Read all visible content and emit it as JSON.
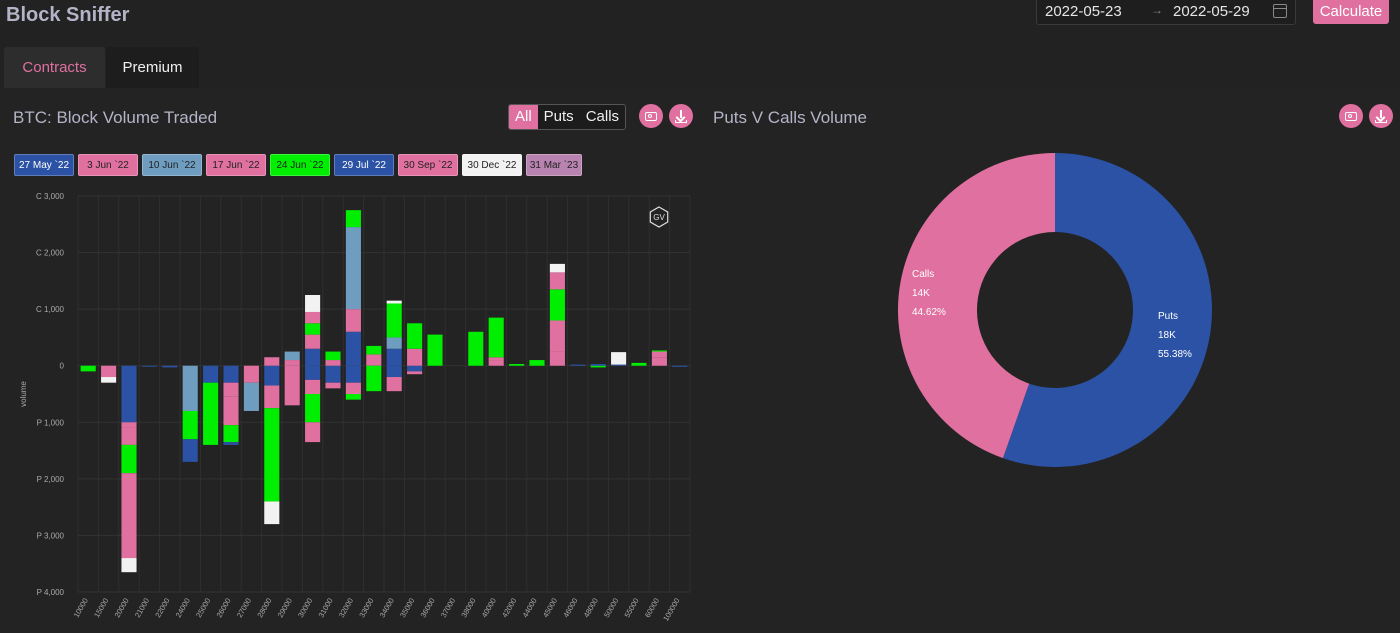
{
  "app": {
    "title": "Block Sniffer"
  },
  "date_range": {
    "start": "2022-05-23",
    "end": "2022-05-29",
    "separator": "→"
  },
  "calculate_label": "Calculate",
  "tabs": [
    {
      "label": "Contracts",
      "active": true
    },
    {
      "label": "Premium",
      "active": false
    }
  ],
  "left_panel": {
    "title": "BTC: Block Volume Traded",
    "filters": [
      {
        "label": "All",
        "active": true
      },
      {
        "label": "Puts",
        "active": false
      },
      {
        "label": "Calls",
        "active": false
      }
    ],
    "watermark": "GV"
  },
  "right_panel": {
    "title": "Puts V Calls Volume"
  },
  "colors": {
    "accent": "#e0709f",
    "bg": "#222222"
  },
  "chart_data": [
    {
      "type": "bar",
      "stacked": true,
      "ylabel": "volume",
      "ylim": [
        -4000,
        3000
      ],
      "y_ticks": [
        {
          "v": 3000,
          "label": "C 3,000"
        },
        {
          "v": 2000,
          "label": "C 2,000"
        },
        {
          "v": 1000,
          "label": "C 1,000"
        },
        {
          "v": 0,
          "label": "0"
        },
        {
          "v": -1000,
          "label": "P 1,000"
        },
        {
          "v": -2000,
          "label": "P 2,000"
        },
        {
          "v": -3000,
          "label": "P 3,000"
        },
        {
          "v": -4000,
          "label": "P 4,000"
        }
      ],
      "categories": [
        "10000",
        "15000",
        "20000",
        "21000",
        "22000",
        "24000",
        "25000",
        "26000",
        "27000",
        "28000",
        "29000",
        "30000",
        "31000",
        "32000",
        "33000",
        "34000",
        "35000",
        "36000",
        "37000",
        "38000",
        "40000",
        "42000",
        "44000",
        "45000",
        "46000",
        "48000",
        "50000",
        "55000",
        "60000",
        "100000"
      ],
      "series": [
        {
          "name": "27 May `22",
          "color": "#2b52a4",
          "calls": [
            0,
            0,
            0,
            0,
            0,
            0,
            0,
            0,
            0,
            0,
            0,
            300,
            0,
            600,
            0,
            300,
            0,
            0,
            0,
            0,
            0,
            0,
            0,
            0,
            20,
            0,
            20,
            0,
            0,
            0
          ],
          "puts": [
            0,
            0,
            1000,
            10,
            30,
            0,
            300,
            300,
            0,
            350,
            0,
            250,
            300,
            300,
            0,
            200,
            100,
            0,
            0,
            0,
            0,
            0,
            0,
            0,
            0,
            0,
            0,
            0,
            0,
            20
          ]
        },
        {
          "name": "3 Jun `22",
          "color": "#e0709f",
          "calls": [
            0,
            0,
            0,
            0,
            0,
            0,
            0,
            0,
            0,
            0,
            100,
            250,
            100,
            400,
            200,
            0,
            300,
            0,
            0,
            0,
            100,
            0,
            0,
            250,
            0,
            0,
            0,
            0,
            150,
            0
          ],
          "puts": [
            0,
            200,
            100,
            0,
            0,
            0,
            0,
            250,
            300,
            0,
            0,
            250,
            100,
            200,
            0,
            0,
            50,
            0,
            0,
            0,
            0,
            0,
            0,
            0,
            0,
            0,
            0,
            0,
            0,
            0
          ]
        },
        {
          "name": "10 Jun `22",
          "color": "#6f9dc0",
          "calls": [
            0,
            0,
            0,
            0,
            0,
            0,
            0,
            0,
            0,
            0,
            150,
            0,
            0,
            1450,
            0,
            200,
            0,
            0,
            0,
            0,
            0,
            0,
            0,
            0,
            0,
            0,
            0,
            0,
            0,
            0
          ],
          "puts": [
            0,
            0,
            0,
            0,
            0,
            800,
            0,
            0,
            500,
            0,
            0,
            0,
            0,
            0,
            0,
            0,
            0,
            0,
            0,
            0,
            0,
            0,
            0,
            0,
            0,
            0,
            0,
            0,
            0,
            0
          ]
        },
        {
          "name": "17 Jun `22",
          "color": "#e0709f",
          "calls": [
            0,
            0,
            0,
            0,
            0,
            0,
            0,
            0,
            0,
            150,
            0,
            0,
            0,
            0,
            0,
            0,
            0,
            0,
            0,
            0,
            50,
            0,
            0,
            550,
            0,
            0,
            0,
            0,
            100,
            0
          ],
          "puts": [
            0,
            0,
            300,
            0,
            0,
            0,
            0,
            500,
            0,
            400,
            700,
            0,
            0,
            0,
            0,
            250,
            0,
            0,
            0,
            0,
            0,
            0,
            0,
            0,
            0,
            0,
            0,
            0,
            0,
            0
          ]
        },
        {
          "name": "24 Jun `22",
          "color": "#00ee00",
          "calls": [
            0,
            0,
            0,
            0,
            0,
            0,
            0,
            0,
            0,
            0,
            0,
            200,
            150,
            300,
            150,
            600,
            450,
            550,
            0,
            600,
            700,
            30,
            100,
            550,
            0,
            0,
            0,
            50,
            20,
            0
          ],
          "puts": [
            100,
            0,
            500,
            0,
            0,
            500,
            1100,
            300,
            0,
            1650,
            0,
            500,
            0,
            100,
            450,
            0,
            0,
            0,
            0,
            0,
            0,
            0,
            0,
            0,
            0,
            30,
            0,
            0,
            0,
            0
          ]
        },
        {
          "name": "29 Jul `22",
          "color": "#2b52a4",
          "calls": [
            0,
            0,
            0,
            0,
            0,
            0,
            0,
            0,
            0,
            0,
            0,
            0,
            0,
            0,
            0,
            0,
            0,
            0,
            0,
            0,
            0,
            0,
            0,
            0,
            0,
            30,
            0,
            0,
            0,
            0
          ],
          "puts": [
            0,
            0,
            0,
            0,
            0,
            400,
            0,
            50,
            0,
            0,
            0,
            0,
            0,
            0,
            0,
            0,
            0,
            0,
            0,
            0,
            0,
            0,
            0,
            0,
            0,
            0,
            0,
            0,
            0,
            0
          ]
        },
        {
          "name": "30 Sep `22",
          "color": "#e0709f",
          "calls": [
            0,
            0,
            0,
            0,
            0,
            0,
            0,
            0,
            0,
            0,
            0,
            200,
            0,
            0,
            0,
            0,
            0,
            0,
            0,
            0,
            0,
            0,
            0,
            300,
            0,
            0,
            0,
            0,
            0,
            0
          ],
          "puts": [
            0,
            0,
            1500,
            0,
            0,
            0,
            0,
            0,
            0,
            0,
            0,
            350,
            0,
            0,
            0,
            0,
            0,
            0,
            0,
            0,
            0,
            0,
            0,
            0,
            0,
            0,
            0,
            0,
            0,
            0
          ]
        },
        {
          "name": "30 Dec `22",
          "color": "#f2f2f2",
          "calls": [
            0,
            0,
            0,
            0,
            0,
            0,
            0,
            0,
            0,
            0,
            0,
            300,
            0,
            0,
            0,
            50,
            0,
            0,
            0,
            0,
            0,
            0,
            0,
            150,
            0,
            0,
            220,
            0,
            0,
            0
          ],
          "puts": [
            0,
            100,
            250,
            0,
            0,
            0,
            0,
            0,
            0,
            400,
            0,
            0,
            0,
            0,
            0,
            0,
            0,
            0,
            0,
            0,
            0,
            0,
            0,
            0,
            0,
            0,
            0,
            0,
            0,
            0
          ]
        },
        {
          "name": "31 Mar `23",
          "color": "#b883b0",
          "calls": [
            0,
            0,
            0,
            0,
            0,
            0,
            0,
            0,
            0,
            0,
            0,
            0,
            0,
            0,
            0,
            0,
            0,
            0,
            0,
            0,
            0,
            0,
            0,
            0,
            0,
            0,
            0,
            0,
            0,
            0
          ],
          "puts": [
            0,
            0,
            0,
            0,
            0,
            0,
            0,
            0,
            0,
            0,
            0,
            0,
            0,
            0,
            0,
            0,
            0,
            0,
            0,
            0,
            0,
            0,
            0,
            0,
            0,
            0,
            0,
            0,
            0,
            0
          ]
        }
      ]
    },
    {
      "type": "pie",
      "donut": true,
      "slices": [
        {
          "name": "Puts",
          "value_label": "18K",
          "percent": 55.38,
          "percent_label": "55.38%",
          "color": "#2b52a4"
        },
        {
          "name": "Calls",
          "value_label": "14K",
          "percent": 44.62,
          "percent_label": "44.62%",
          "color": "#e0709f"
        }
      ]
    }
  ]
}
